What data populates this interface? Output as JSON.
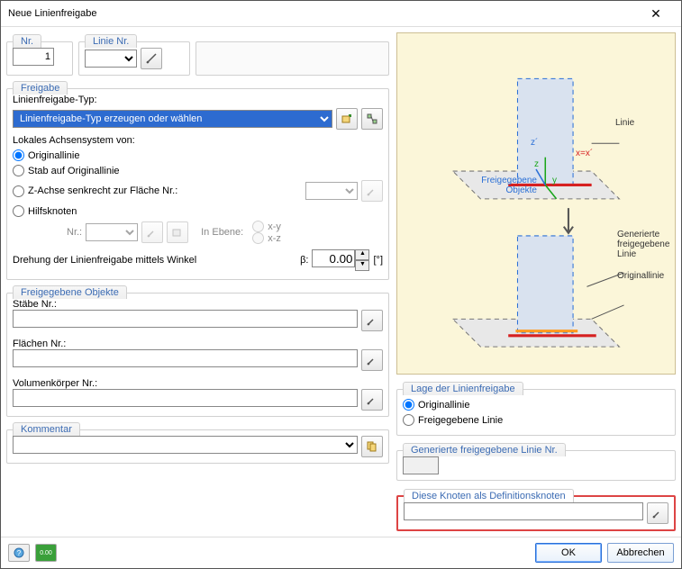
{
  "window": {
    "title": "Neue Linienfreigabe"
  },
  "top": {
    "nr_label": "Nr.",
    "nr_value": "1",
    "line_nr_label": "Linie Nr.",
    "line_nr_value": ""
  },
  "freigabe": {
    "legend": "Freigabe",
    "typ_label": "Linienfreigabe-Typ:",
    "typ_value": "Linienfreigabe-Typ erzeugen oder wählen",
    "local_label": "Lokales Achsensystem von:",
    "options": {
      "original": "Originallinie",
      "member": "Stab auf Originallinie",
      "zaxis": "Z-Achse senkrecht zur Fläche Nr.:",
      "helpnode": "Hilfsknoten"
    },
    "nr_label": "Nr.:",
    "in_plane_label": "In Ebene:",
    "plane_xy": "x-y",
    "plane_xz": "x-z",
    "rotation_label": "Drehung der Linienfreigabe mittels Winkel",
    "beta_label": "β:",
    "rotation_value": "0.00",
    "rotation_unit": "[°]"
  },
  "released": {
    "legend": "Freigegebene Objekte",
    "members_label": "Stäbe Nr.:",
    "surfaces_label": "Flächen Nr.:",
    "solids_label": "Volumenkörper Nr.:"
  },
  "comment": {
    "legend": "Kommentar"
  },
  "diagram": {
    "linie": "Linie",
    "released_objects_a": "Freigegebene",
    "released_objects_b": "Objekte",
    "axis_z1": "z´",
    "axis_z": "z",
    "axis_y": "y",
    "axis_x": "x=x´",
    "generated_a": "Generierte",
    "generated_b": "freigegebene",
    "generated_c": "Linie",
    "origline": "Originallinie"
  },
  "location": {
    "legend": "Lage der Linienfreigabe",
    "original": "Originallinie",
    "released": "Freigegebene Linie"
  },
  "generated": {
    "legend": "Generierte freigegebene Linie Nr.",
    "value": ""
  },
  "defnodes": {
    "legend": "Diese Knoten als Definitionsknoten",
    "value": ""
  },
  "footer": {
    "ok": "OK",
    "cancel": "Abbrechen"
  }
}
